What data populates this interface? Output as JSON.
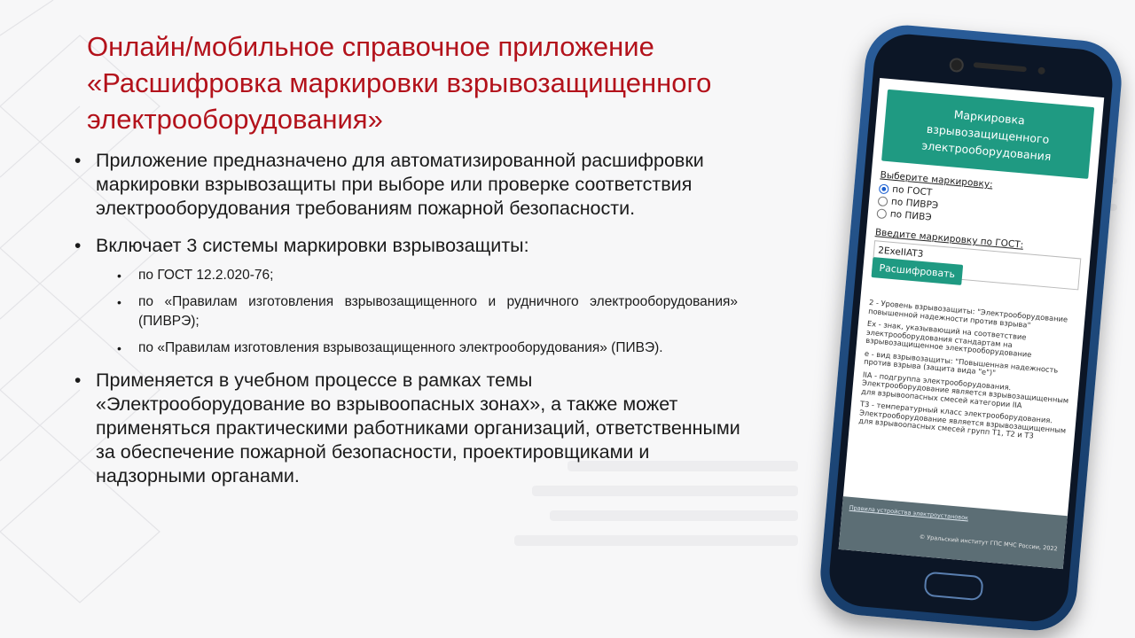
{
  "slide": {
    "title_lines": [
      "Онлайн/мобильное справочное приложение",
      "«Расшифровка маркировки взрывозащищенного",
      "электрооборудования»"
    ],
    "bullets": [
      "Приложение предназначено для автоматизированной расшифровки маркировки взрывозащиты при выборе или проверке соответствия электрооборудования требованиям пожарной безопасности.",
      "Включает 3 системы маркировки взрывозащиты:",
      "Применяется в учебном процессе в рамках темы «Электрооборудование во взрывоопасных зонах», а также может применяться практическими работниками организаций, ответственными за обеспечение пожарной безопасности, проектировщиками и надзорными органами."
    ],
    "sub_bullets": [
      "по ГОСТ 12.2.020-76;",
      "по «Правилам изготовления взрывозащищенного и рудничного электрооборудования» (ПИВРЭ);",
      "по «Правилам изготовления взрывозащищенного электрооборудования» (ПИВЭ)."
    ]
  },
  "app": {
    "header": "Маркировка взрывозащищенного электрооборудования",
    "select_label": "Выберите маркировку:",
    "options": [
      "по ГОСТ",
      "по ПИВРЭ",
      "по ПИВЭ"
    ],
    "selected_option": "по ГОСТ",
    "input_label": "Введите маркировку по ГОСТ:",
    "input_value": "2ExeIIAT3",
    "decode_button": "Расшифровать",
    "results": [
      "2 - Уровень взрывозащиты: \"Электрооборудование повышенной надежности против взрыва\"",
      "Ex - знак, указывающий на соответствие электрооборудования стандартам на взрывозащищенное электрооборудование",
      "e - вид взрывозащиты: \"Повышенная надежность против взрыва (защита вида \"e\")\"",
      "IIA - подгруппа электрооборудования. Электрооборудование является взрывозащищенным для взрывоопасных смесей категории IIA",
      "T3 - температурный класс электрооборудования. Электрооборудование является взрывозащищенным для взрывоопасных смесей групп T1, T2 и T3"
    ],
    "footer_link": "Правила устройства электроустановок",
    "footer_copyright": "© Уральский институт ГПС МЧС России, 2022"
  },
  "colors": {
    "title": "#b3121b",
    "app_accent": "#1f9a82",
    "phone_body": "#1d4778",
    "footer_bg": "#5c6e75"
  }
}
